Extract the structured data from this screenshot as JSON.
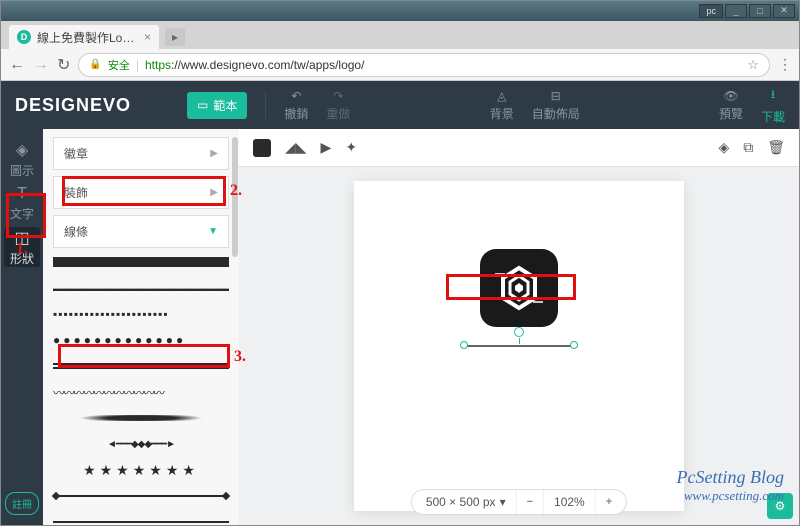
{
  "window": {
    "pc_label": "pc",
    "min": "_",
    "max": "□",
    "close": "✕"
  },
  "tab": {
    "title": "線上免費製作Logo，定",
    "favicon": "D",
    "close": "×"
  },
  "nav": {
    "back": "←",
    "fwd": "→",
    "reload": "↻"
  },
  "url": {
    "lock": "🔒",
    "secure": "安全",
    "proto": "https",
    "rest": "://www.designevo.com/tw/apps/logo/",
    "star": "☆",
    "menu": "⋮"
  },
  "header": {
    "logo": "DESIGNEVO",
    "template_btn": "範本",
    "undo": "撤銷",
    "redo": "重做",
    "background": "背景",
    "autolayout": "自動佈局",
    "preview": "預覽",
    "download": "下載"
  },
  "rail": {
    "icon": "圖示",
    "text": "文字",
    "shape": "形狀",
    "register": "註冊"
  },
  "panel": {
    "cat_badge": "徽章",
    "cat_decor": "裝飾",
    "cat_line": "線條"
  },
  "toolbar": {
    "flip_h": "◢◣",
    "flip_v": "▶",
    "fx": "✦"
  },
  "toolbar_right": {
    "layers": "◈",
    "copy": "⧉",
    "delete": "🗑"
  },
  "bottom": {
    "size": "500 × 500 px",
    "dd": "▾",
    "minus": "−",
    "zoom": "102%",
    "plus": "+"
  },
  "gear": "⚙",
  "annot": {
    "n1": "1.",
    "n2": "2.",
    "n3": "3."
  },
  "watermark": {
    "line1": "PcSetting Blog",
    "line2": "www.pcsetting.com"
  }
}
